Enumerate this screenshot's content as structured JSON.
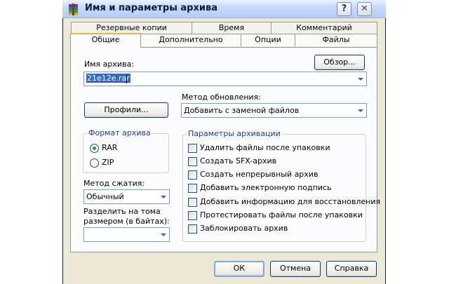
{
  "window": {
    "title": "Имя и параметры архива",
    "help_button": "?",
    "close_button": "✕"
  },
  "tabs": {
    "row_back": [
      "Резервные копии",
      "Время",
      "Комментарий"
    ],
    "row_front": [
      "Общие",
      "Дополнительно",
      "Опции",
      "Файлы"
    ],
    "active": "Общие"
  },
  "archive_name": {
    "label": "Имя архива:",
    "value": "21e12e.rar",
    "browse_button": "Обзор..."
  },
  "update_method": {
    "label": "Метод обновления:",
    "value": "Добавить с заменой файлов"
  },
  "profiles_button": "Профили...",
  "format": {
    "legend": "Формат архива",
    "options": [
      "RAR",
      "ZIP"
    ],
    "selected": "RAR"
  },
  "compression": {
    "label": "Метод сжатия:",
    "value": "Обычный"
  },
  "split": {
    "label_line1": "Разделить на тома",
    "label_line2": "размером (в байтах):",
    "value": ""
  },
  "options": {
    "legend": "Параметры архивации",
    "items": [
      {
        "label": "Удалить файлы после упаковки",
        "checked": false
      },
      {
        "label": "Создать SFX-архив",
        "checked": false
      },
      {
        "label": "Создать непрерывный архив",
        "checked": false
      },
      {
        "label": "Добавить электронную подпись",
        "checked": false
      },
      {
        "label": "Добавить информацию для восстановления",
        "checked": false
      },
      {
        "label": "Протестировать файлы после упаковки",
        "checked": false
      },
      {
        "label": "Заблокировать архив",
        "checked": false
      }
    ]
  },
  "buttons": {
    "ok": "ОК",
    "cancel": "Отмена",
    "help": "Справка"
  },
  "colors": {
    "accent_tab": "#f0b43a",
    "selection": "#316ac5",
    "radio_dot": "#21a121",
    "window_bg": "#ece9d8"
  }
}
